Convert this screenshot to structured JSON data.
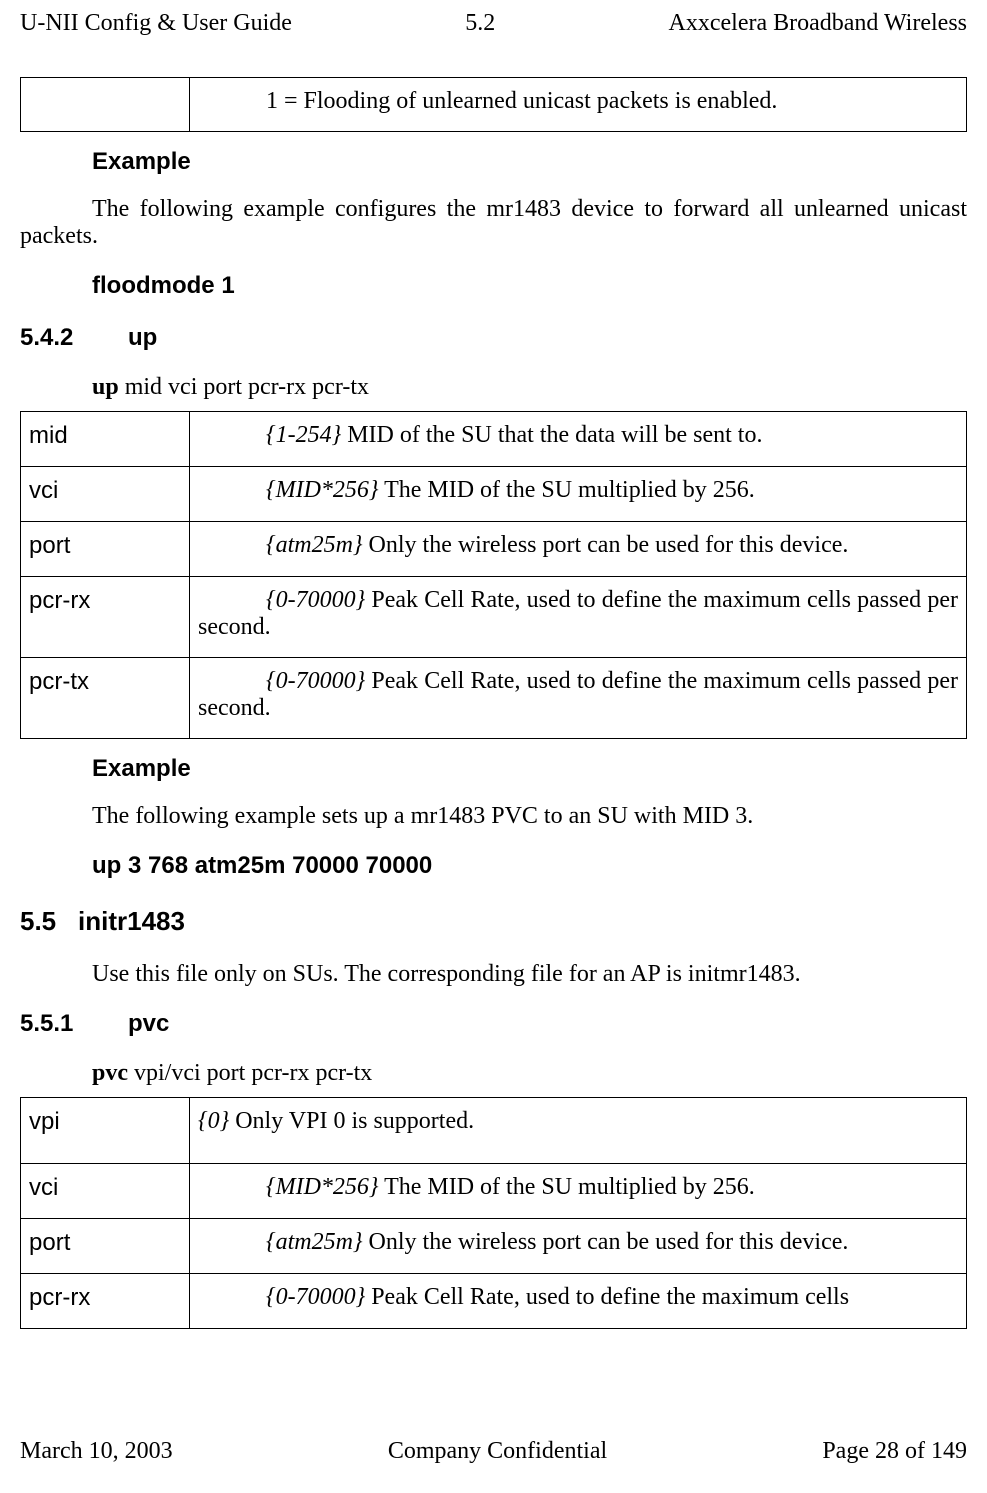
{
  "header": {
    "left": "U-NII Config & User Guide",
    "center": "5.2",
    "right": "Axxcelera Broadband Wireless"
  },
  "footer": {
    "left": "March 10, 2003",
    "center": "Company Confidential",
    "right": "Page 28 of 149"
  },
  "topTable": {
    "key": "",
    "descPrefix": "1 = Flooding of unlearned unicast packets is enabled."
  },
  "example1": {
    "heading": "Example",
    "text": "The following example configures the mr1483 device to forward all unlearned unicast packets.",
    "cmd": "floodmode   1"
  },
  "sec542": {
    "num": "5.4.2",
    "title": "up",
    "syntaxKw": "up",
    "syntaxArgs": "   mid   vci   port   pcr-rx   pcr-tx",
    "rows": [
      {
        "key": "mid",
        "range": "{1-254}",
        "desc": " MID of the SU that the data will be sent to."
      },
      {
        "key": "vci",
        "range": "{MID*256}",
        "desc": " The MID of the SU multiplied by 256."
      },
      {
        "key": "port",
        "range": "{atm25m}",
        "desc": " Only the wireless port can be used for this device."
      },
      {
        "key": "pcr-rx",
        "range": "{0-70000}",
        "desc": " Peak Cell Rate, used to define the maximum cells passed per second."
      },
      {
        "key": "pcr-tx",
        "range": "{0-70000}",
        "desc": " Peak Cell Rate, used to define the maximum cells passed per second."
      }
    ],
    "exampleHeading": "Example",
    "exampleText": "The following example sets up a mr1483 PVC to an SU with MID 3.",
    "exampleCmd": "up   3   768   atm25m   70000   70000"
  },
  "sec55": {
    "num": "5.5",
    "title": "initr1483",
    "text": "Use this file only on SUs.  The corresponding file for an AP is initmr1483."
  },
  "sec551": {
    "num": "5.5.1",
    "title": "pvc",
    "syntaxKw": "pvc",
    "syntaxArgs": "   vpi/vci   port   pcr-rx   pcr-tx",
    "rows": [
      {
        "key": "vpi",
        "range": "{0}",
        "desc": " Only VPI 0 is supported.",
        "noIndent": true
      },
      {
        "key": "vci",
        "range": "{MID*256}",
        "desc": " The MID of the SU multiplied by 256."
      },
      {
        "key": "port",
        "range": "{atm25m}",
        "desc": " Only the wireless port can be used for this device."
      },
      {
        "key": "pcr-rx",
        "range": "{0-70000}",
        "desc": " Peak Cell Rate, used to define the maximum cells"
      }
    ]
  }
}
